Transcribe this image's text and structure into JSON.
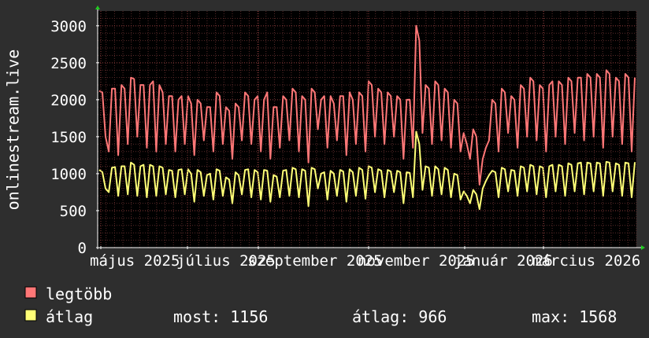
{
  "chart_data": {
    "type": "line",
    "ylabel": "onlinestream.live",
    "ylim": [
      0,
      3200
    ],
    "yticks": [
      0,
      500,
      1000,
      1500,
      2000,
      2500,
      3000
    ],
    "xticks": [
      "május 2025",
      "július 2025",
      "szeptember 2025",
      "november 2025",
      "január 2026",
      "március 2026"
    ],
    "grid": true,
    "colors": {
      "background": "#2e2e2e",
      "plot": "#000000",
      "grid": "#5a2a2a",
      "axis": "#ffffff",
      "legtobb": "#ff7777",
      "atlag": "#ffff77"
    },
    "series": [
      {
        "name": "legtöbb",
        "values": [
          2120,
          2100,
          1500,
          1300,
          2150,
          2150,
          1250,
          2200,
          2150,
          1400,
          2300,
          2280,
          1500,
          2200,
          2200,
          1350,
          2200,
          2250,
          1300,
          2200,
          2100,
          1400,
          2050,
          2050,
          1300,
          2000,
          2050,
          1400,
          2050,
          1950,
          1250,
          2000,
          1950,
          1450,
          1900,
          1900,
          1300,
          2100,
          2050,
          1400,
          1900,
          1850,
          1200,
          1950,
          1900,
          1450,
          2100,
          2050,
          1400,
          2000,
          2050,
          1300,
          2000,
          2100,
          1200,
          1900,
          1900,
          1350,
          2050,
          2000,
          1450,
          2150,
          2100,
          1300,
          2050,
          2000,
          1150,
          2150,
          2100,
          1600,
          2000,
          2050,
          1350,
          2050,
          1950,
          1450,
          2050,
          2050,
          1250,
          2100,
          2000,
          1400,
          2100,
          2050,
          1300,
          2250,
          2200,
          1500,
          2150,
          2100,
          1400,
          2100,
          2050,
          1500,
          2050,
          2000,
          1200,
          2000,
          2000,
          1350,
          3000,
          2800,
          1550,
          2200,
          2150,
          1400,
          2250,
          2200,
          1450,
          2150,
          2100,
          1350,
          2000,
          1950,
          1300,
          1550,
          1400,
          1200,
          1600,
          1500,
          850,
          1200,
          1350,
          1450,
          2000,
          1950,
          1300,
          2150,
          2100,
          1550,
          2050,
          2000,
          1350,
          2200,
          2150,
          1500,
          2300,
          2250,
          1450,
          2200,
          2150,
          1300,
          2200,
          2250,
          1500,
          2250,
          2200,
          1400,
          2300,
          2250,
          1550,
          2300,
          2300,
          1450,
          2350,
          2300,
          1500,
          2350,
          2300,
          1350,
          2400,
          2350,
          1500,
          2300,
          2250,
          1400,
          2350,
          2300,
          1300,
          2300
        ]
      },
      {
        "name": "átlag",
        "values": [
          1050,
          1020,
          800,
          750,
          1080,
          1090,
          700,
          1100,
          1100,
          720,
          1150,
          1120,
          700,
          1100,
          1120,
          680,
          1120,
          1100,
          700,
          1100,
          1080,
          720,
          1050,
          1040,
          680,
          1050,
          1060,
          720,
          1060,
          1000,
          620,
          1050,
          1020,
          700,
          980,
          1000,
          650,
          1060,
          1040,
          700,
          950,
          920,
          600,
          1020,
          980,
          720,
          1050,
          1060,
          680,
          1050,
          1020,
          650,
          1050,
          1040,
          620,
          980,
          960,
          680,
          1040,
          1050,
          700,
          1080,
          1060,
          680,
          1060,
          1040,
          560,
          1080,
          1060,
          800,
          1000,
          1020,
          650,
          1040,
          1000,
          700,
          1050,
          1030,
          620,
          1060,
          1020,
          700,
          1080,
          1050,
          660,
          1100,
          1080,
          750,
          1060,
          1040,
          680,
          1050,
          1030,
          750,
          1040,
          1020,
          600,
          1020,
          1010,
          680,
          1568,
          1400,
          780,
          1100,
          1080,
          700,
          1100,
          1060,
          720,
          1080,
          1050,
          680,
          1000,
          980,
          650,
          760,
          700,
          600,
          780,
          720,
          520,
          800,
          900,
          980,
          1040,
          1020,
          680,
          1080,
          1060,
          760,
          1050,
          1040,
          700,
          1100,
          1080,
          760,
          1120,
          1100,
          720,
          1100,
          1080,
          680,
          1100,
          1120,
          760,
          1120,
          1100,
          700,
          1140,
          1120,
          760,
          1140,
          1150,
          720,
          1150,
          1140,
          760,
          1150,
          1140,
          700,
          1160,
          1150,
          760,
          1140,
          1120,
          700,
          1150,
          1140,
          680,
          1156
        ]
      }
    ]
  },
  "legend": {
    "items": [
      {
        "label": "legtöbb",
        "color": "#ff7777"
      },
      {
        "label": "átlag",
        "color": "#ffff77"
      }
    ],
    "stats": {
      "most": "most: 1156",
      "atlag": "átlag: 966",
      "max": "max: 1568"
    }
  }
}
